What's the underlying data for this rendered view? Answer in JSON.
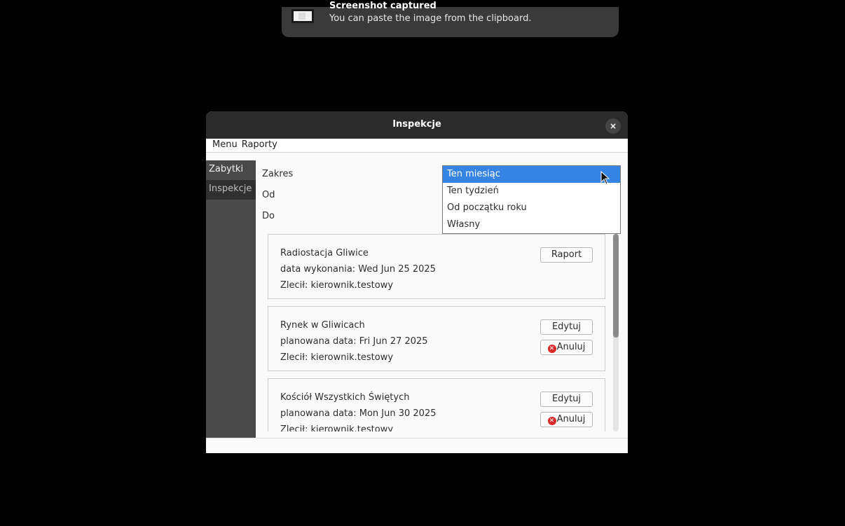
{
  "notification": {
    "title": "Screenshot captured",
    "body": "You can paste the image from the clipboard."
  },
  "window": {
    "title": "Inspekcje",
    "close_glyph": "×"
  },
  "menubar": {
    "items": [
      "Menu",
      "Raporty"
    ]
  },
  "sidebar": {
    "items": [
      {
        "label": "Zabytki",
        "active": false
      },
      {
        "label": "Inspekcje",
        "active": true
      }
    ]
  },
  "filters": {
    "range_label": "Zakres",
    "from_label": "Od",
    "to_label": "Do"
  },
  "dropdown": {
    "options": [
      "Ten miesiąc",
      "Ten tydzień",
      "Od początku roku",
      "Własny"
    ],
    "selected_index": 0
  },
  "inspections": [
    {
      "name": "Radiostacja Gliwice",
      "date_line": "data wykonania: Wed Jun 25 2025",
      "ordered_line": "Zlecił: kierownik.testowy",
      "buttons": [
        "Raport"
      ]
    },
    {
      "name": "Rynek w Gliwicach",
      "date_line": "planowana data: Fri Jun 27 2025",
      "ordered_line": "Zlecił: kierownik.testowy",
      "buttons": [
        "Edytuj",
        "Anuluj"
      ]
    },
    {
      "name": "Kościół Wszystkich Świętych",
      "date_line": "planowana data: Mon Jun 30 2025",
      "ordered_line": "Zlecił: kierownik.testowy",
      "buttons": [
        "Edytuj",
        "Anuluj"
      ]
    }
  ],
  "icons": {
    "cancel": "cancel-circle-icon",
    "cancel_glyph": "✕",
    "close": "close-icon",
    "cursor": "mouse-pointer-icon"
  },
  "colors": {
    "selection": "#3584e4",
    "cancel_red": "#d9292b",
    "titlebar": "#2b2b2b",
    "sidebar": "#4a4a4a"
  }
}
